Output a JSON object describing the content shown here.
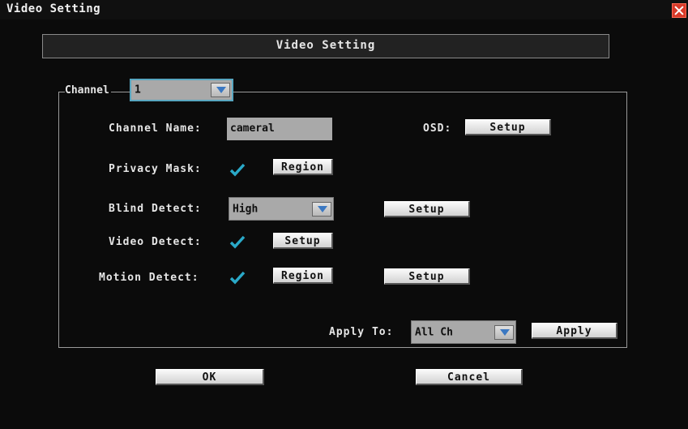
{
  "window": {
    "title": "Video Setting"
  },
  "header": {
    "title": "Video Setting"
  },
  "channel": {
    "label": "Channel",
    "value": "1"
  },
  "channel_name": {
    "label": "Channel Name:",
    "value": "cameral"
  },
  "osd": {
    "label": "OSD:",
    "button": "Setup"
  },
  "privacy_mask": {
    "label": "Privacy Mask:",
    "checked": true,
    "button": "Region"
  },
  "blind_detect": {
    "label": "Blind Detect:",
    "value": "High",
    "button": "Setup"
  },
  "video_detect": {
    "label": "Video Detect:",
    "checked": true,
    "button": "Setup"
  },
  "motion_detect": {
    "label": "Motion Detect:",
    "checked": true,
    "region_button": "Region",
    "setup_button": "Setup"
  },
  "apply_to": {
    "label": "Apply To:",
    "value": "All Ch",
    "button": "Apply"
  },
  "footer": {
    "ok": "OK",
    "cancel": "Cancel"
  },
  "colors": {
    "check": "#2aa9c8",
    "accent": "#3b78c2",
    "close": "#d83a2a"
  }
}
